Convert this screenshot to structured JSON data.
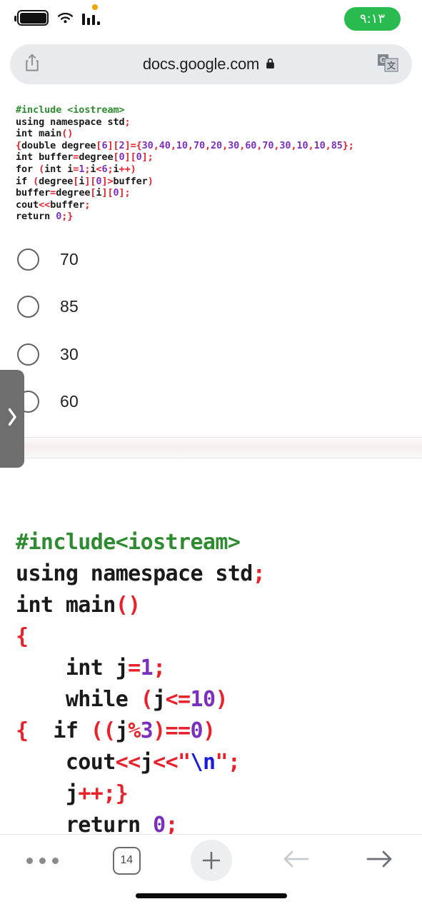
{
  "status_bar": {
    "battery_icon": "battery-full-icon",
    "wifi_icon": "wifi-icon",
    "signal_icon": "cellular-signal-icon",
    "notification_dot": "amber-status-dot",
    "time": "٩:١٣"
  },
  "address_bar": {
    "share_icon": "share-icon",
    "url": "docs.google.com",
    "lock_icon": "lock-icon",
    "translate_icon": "google-translate-icon"
  },
  "question_one": {
    "code_lines": [
      [
        {
          "t": "#include <iostream>",
          "c": "green"
        }
      ],
      [
        {
          "t": "using namespace std",
          "c": "txt"
        },
        {
          "t": ";",
          "c": "red"
        }
      ],
      [
        {
          "t": "int main",
          "c": "txt"
        },
        {
          "t": "()",
          "c": "red"
        }
      ],
      [
        {
          "t": "{",
          "c": "red"
        },
        {
          "t": "double degree",
          "c": "txt"
        },
        {
          "t": "[",
          "c": "red"
        },
        {
          "t": "6",
          "c": "pur"
        },
        {
          "t": "][",
          "c": "red"
        },
        {
          "t": "2",
          "c": "pur"
        },
        {
          "t": "]=",
          "c": "red"
        },
        {
          "t": "{",
          "c": "red"
        },
        {
          "t": "30",
          "c": "pur"
        },
        {
          "t": ",",
          "c": "red"
        },
        {
          "t": "40",
          "c": "pur"
        },
        {
          "t": ",",
          "c": "red"
        },
        {
          "t": "10",
          "c": "pur"
        },
        {
          "t": ",",
          "c": "red"
        },
        {
          "t": "70",
          "c": "pur"
        },
        {
          "t": ",",
          "c": "red"
        },
        {
          "t": "20",
          "c": "pur"
        },
        {
          "t": ",",
          "c": "red"
        },
        {
          "t": "30",
          "c": "pur"
        },
        {
          "t": ",",
          "c": "red"
        },
        {
          "t": "60",
          "c": "pur"
        },
        {
          "t": ",",
          "c": "red"
        },
        {
          "t": "70",
          "c": "pur"
        },
        {
          "t": ",",
          "c": "red"
        },
        {
          "t": "30",
          "c": "pur"
        },
        {
          "t": ",",
          "c": "red"
        },
        {
          "t": "10",
          "c": "pur"
        },
        {
          "t": ",",
          "c": "red"
        },
        {
          "t": "10",
          "c": "pur"
        },
        {
          "t": ",",
          "c": "red"
        },
        {
          "t": "85",
          "c": "pur"
        },
        {
          "t": "};",
          "c": "red"
        }
      ],
      [
        {
          "t": "int buffer",
          "c": "txt"
        },
        {
          "t": "=",
          "c": "red"
        },
        {
          "t": "degree",
          "c": "txt"
        },
        {
          "t": "[",
          "c": "red"
        },
        {
          "t": "0",
          "c": "pur"
        },
        {
          "t": "][",
          "c": "red"
        },
        {
          "t": "0",
          "c": "pur"
        },
        {
          "t": "];",
          "c": "red"
        }
      ],
      [
        {
          "t": "for ",
          "c": "txt"
        },
        {
          "t": "(",
          "c": "red"
        },
        {
          "t": "int i",
          "c": "txt"
        },
        {
          "t": "=",
          "c": "red"
        },
        {
          "t": "1",
          "c": "pur"
        },
        {
          "t": ";",
          "c": "red"
        },
        {
          "t": "i",
          "c": "txt"
        },
        {
          "t": "<",
          "c": "red"
        },
        {
          "t": "6",
          "c": "pur"
        },
        {
          "t": ";",
          "c": "red"
        },
        {
          "t": "i",
          "c": "txt"
        },
        {
          "t": "++)",
          "c": "red"
        }
      ],
      [
        {
          "t": "if ",
          "c": "txt"
        },
        {
          "t": "(",
          "c": "red"
        },
        {
          "t": "degree",
          "c": "txt"
        },
        {
          "t": "[",
          "c": "red"
        },
        {
          "t": "i",
          "c": "txt"
        },
        {
          "t": "][",
          "c": "red"
        },
        {
          "t": "0",
          "c": "pur"
        },
        {
          "t": "]>",
          "c": "red"
        },
        {
          "t": "buffer",
          "c": "txt"
        },
        {
          "t": ")",
          "c": "red"
        }
      ],
      [
        {
          "t": "buffer",
          "c": "txt"
        },
        {
          "t": "=",
          "c": "red"
        },
        {
          "t": "degree",
          "c": "txt"
        },
        {
          "t": "[",
          "c": "red"
        },
        {
          "t": "i",
          "c": "txt"
        },
        {
          "t": "][",
          "c": "red"
        },
        {
          "t": "0",
          "c": "pur"
        },
        {
          "t": "];",
          "c": "red"
        }
      ],
      [
        {
          "t": "cout",
          "c": "txt"
        },
        {
          "t": "<<",
          "c": "red"
        },
        {
          "t": "buffer",
          "c": "txt"
        },
        {
          "t": ";",
          "c": "red"
        }
      ],
      [
        {
          "t": "return ",
          "c": "txt"
        },
        {
          "t": "0",
          "c": "pur"
        },
        {
          "t": ";}",
          "c": "red"
        }
      ]
    ],
    "options": [
      {
        "label": "70",
        "selected": false
      },
      {
        "label": "85",
        "selected": false
      },
      {
        "label": "30",
        "selected": false
      },
      {
        "label": "60",
        "selected": false
      }
    ]
  },
  "question_two": {
    "code_lines": [
      [
        {
          "t": "#include<iostream>",
          "c": "green"
        }
      ],
      [
        {
          "t": "using namespace std",
          "c": "txt"
        },
        {
          "t": ";",
          "c": "red"
        }
      ],
      [
        {
          "t": "int main",
          "c": "txt"
        },
        {
          "t": "()",
          "c": "red"
        }
      ],
      [
        {
          "t": "{",
          "c": "red"
        }
      ],
      [
        {
          "t": "    int j",
          "c": "txt"
        },
        {
          "t": "=",
          "c": "red"
        },
        {
          "t": "1",
          "c": "pur"
        },
        {
          "t": ";",
          "c": "red"
        }
      ],
      [
        {
          "t": "    while ",
          "c": "txt"
        },
        {
          "t": "(",
          "c": "red"
        },
        {
          "t": "j",
          "c": "txt"
        },
        {
          "t": "<=",
          "c": "red"
        },
        {
          "t": "10",
          "c": "pur"
        },
        {
          "t": ")",
          "c": "red"
        }
      ],
      [
        {
          "t": "{",
          "c": "red"
        },
        {
          "t": "  if ",
          "c": "txt"
        },
        {
          "t": "((",
          "c": "red"
        },
        {
          "t": "j",
          "c": "txt"
        },
        {
          "t": "%",
          "c": "red"
        },
        {
          "t": "3",
          "c": "pur"
        },
        {
          "t": ")==",
          "c": "red"
        },
        {
          "t": "0",
          "c": "pur"
        },
        {
          "t": ")",
          "c": "red"
        }
      ],
      [
        {
          "t": "    cout",
          "c": "txt"
        },
        {
          "t": "<<",
          "c": "red"
        },
        {
          "t": "j",
          "c": "txt"
        },
        {
          "t": "<<",
          "c": "red"
        },
        {
          "t": "\"",
          "c": "red"
        },
        {
          "t": "\\n",
          "c": "blue"
        },
        {
          "t": "\"",
          "c": "red"
        },
        {
          "t": ";",
          "c": "red"
        }
      ],
      [
        {
          "t": "    j",
          "c": "txt"
        },
        {
          "t": "++;}",
          "c": "red"
        }
      ],
      [
        {
          "t": "    return ",
          "c": "txt"
        },
        {
          "t": "0",
          "c": "pur"
        },
        {
          "t": ";",
          "c": "red"
        }
      ]
    ]
  },
  "drawer": {
    "toggle_icon": "chevron-right-icon"
  },
  "bottom_bar": {
    "menu_icon": "more-options-icon",
    "tab_count": "14",
    "new_tab_icon": "plus-icon",
    "back_icon": "arrow-left-icon",
    "forward_icon": "arrow-right-icon",
    "home_indicator": "home-indicator-bar"
  },
  "colors": {
    "accent_green": "#29bb4f",
    "syntax_green": "#2e8b30",
    "syntax_red": "#e8212a",
    "syntax_purple": "#7b2fbd",
    "syntax_blue": "#1b1bdd",
    "addressbar_bg": "#e8eaed",
    "drawer_gray": "#6e6e6e"
  }
}
